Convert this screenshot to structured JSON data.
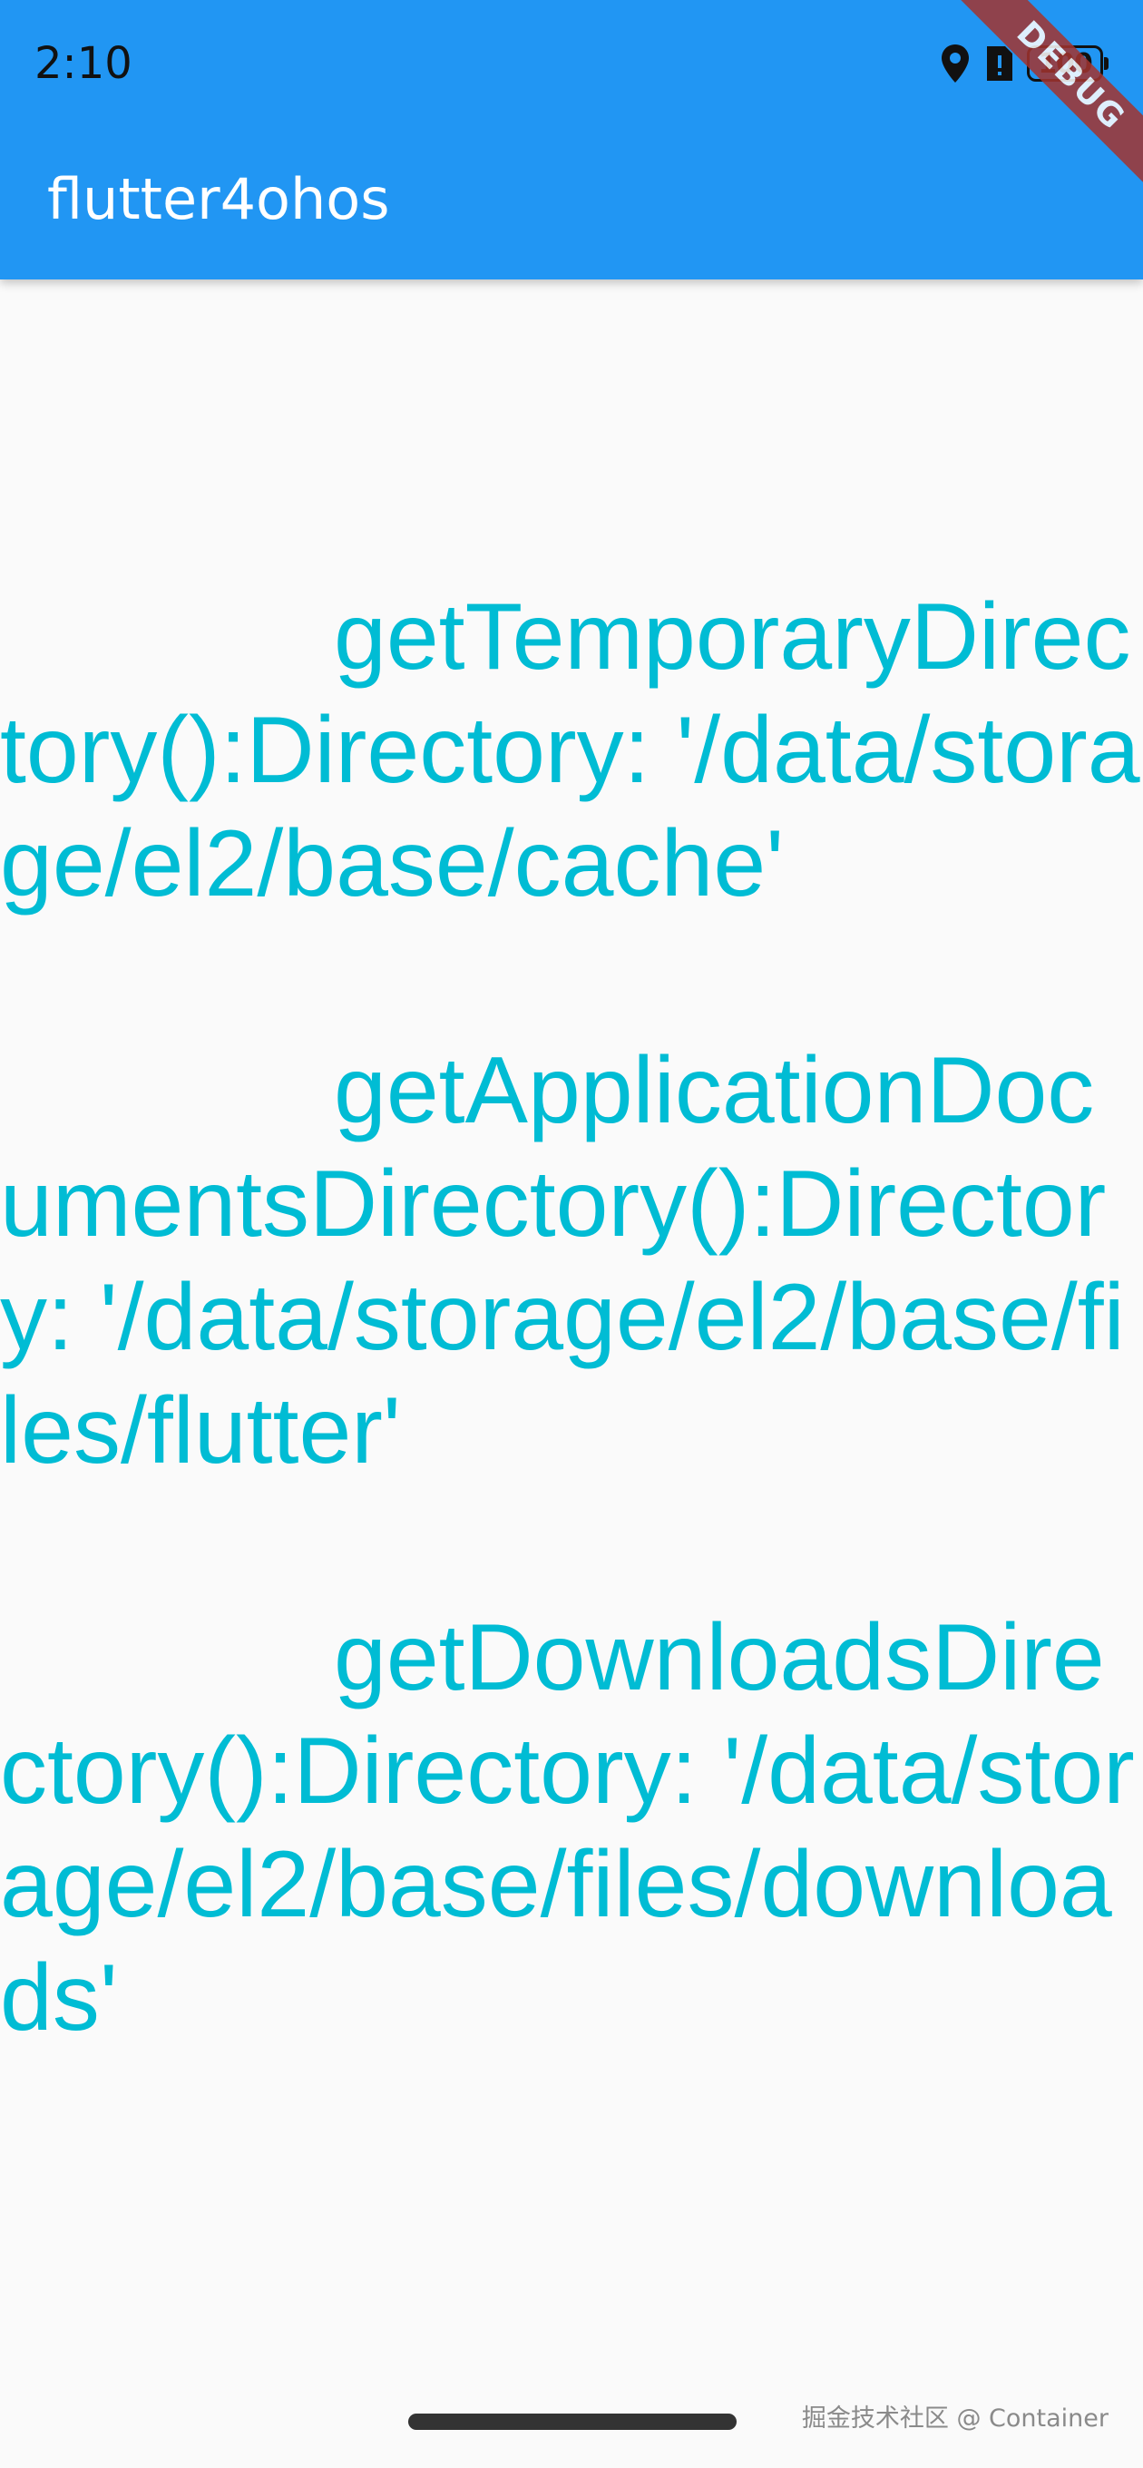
{
  "status_bar": {
    "time": "2:10",
    "battery_level": "100",
    "icons": [
      "location-pin-icon",
      "sim-alert-icon",
      "battery-icon"
    ]
  },
  "app_bar": {
    "title": "flutter4ohos",
    "color": "#2196f3"
  },
  "debug_banner": {
    "label": "DEBUG"
  },
  "entries": [
    {
      "text": "getTemporaryDirectory():Directory: '/data/storage/el2/base/cache'"
    },
    {
      "text": "getApplicationDocumentsDirectory():Directory: '/data/storage/el2/base/files/flutter'"
    },
    {
      "text": "getDownloadsDirectory():Directory: '/data/storage/el2/base/files/downloads'"
    }
  ],
  "text_color": "#00bcd4",
  "watermark": "掘金技术社区 @ Container"
}
